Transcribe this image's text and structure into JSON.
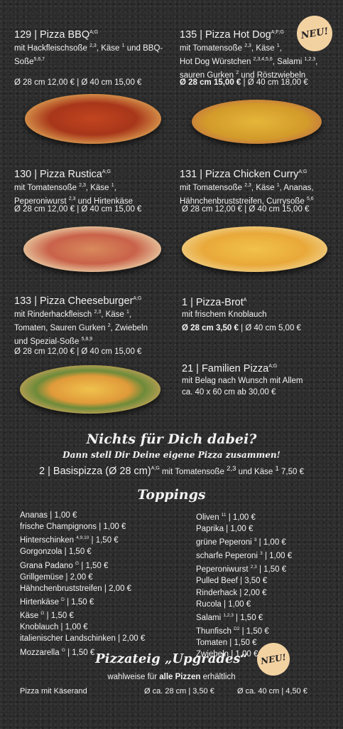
{
  "pizzas": {
    "bbq": {
      "title": "129 | Pizza BBQ",
      "allergens": "A;G",
      "desc_html": "mit Hackfleischsoße <sup>2,3</sup>, Käse <sup>1</sup> und BBQ-Soße<sup>5,6,7</sup>",
      "price_small": "Ø 28 cm 12,00 €",
      "price_large": "Ø 40 cm 15,00 €"
    },
    "hotdog": {
      "title": "135 | Pizza Hot Dog",
      "allergens": "A;F;G",
      "desc_html": "mit Tomatensoße <sup>2,3</sup>, Käse <sup>1</sup>,<br>Hot Dog Würstchen <sup>2,3,4,5,6</sup>, Salami <sup>1,2,3</sup>,<br>sauren Gurken <sup>2</sup> und Röstzwiebeln",
      "price_small": "Ø 28 cm 15,00 €",
      "price_large": "Ø 40 cm 18,00 €"
    },
    "rustica": {
      "title": "130 | Pizza Rustica",
      "allergens": "A;G",
      "desc_html": "mit Tomatensoße <sup>2,3</sup>, Käse <sup>1</sup>,<br>Peperoniwurst <sup>2,3</sup> und Hirtenkäse",
      "price_small": "Ø 28 cm 12,00 €",
      "price_large": "Ø 40 cm 15,00 €"
    },
    "chicken": {
      "title": "131 | Pizza Chicken Curry",
      "allergens": "A;G",
      "desc_html": "mit Tomatensoße <sup>2,3</sup>, Käse <sup>1</sup>, Ananas,<br>Hähnchenbruststreifen, Currysoße <sup>5,6</sup>",
      "price_small": "Ø 28 cm 12,00 €",
      "price_large": "Ø 40 cm 15,00 €"
    },
    "cheese": {
      "title": "133 | Pizza Cheeseburger",
      "allergens": "A;G",
      "desc_html": "mit Rinderhackfleisch <sup>2,3</sup>, Käse <sup>1</sup>,<br>Tomaten,  Sauren Gurken <sup>2</sup>, Zwiebeln<br>und  Spezial-Soße <sup>5,8,9</sup>",
      "price_small": "Ø 28 cm 12,00 €",
      "price_large": "Ø 40 cm 15,00 €"
    },
    "brot": {
      "title": "1 | Pizza-Brot",
      "allergens": "A",
      "desc_html": "mit frischem Knoblauch",
      "price_small": "Ø 28 cm 3,50 €",
      "price_large": "Ø 40 cm 5,00 €"
    },
    "familie": {
      "title": "21 | Familien Pizza",
      "allergens": "A;G",
      "desc_html": "mit Belag nach Wunsch mit Allem<br>ca. 40 x 60 cm ab 30,00 €"
    }
  },
  "badge_new": "NEU!",
  "custom": {
    "heading": "Nichts für Dich dabei?",
    "subheading": "Dann stell Dir Deine eigene Pizza zusammen!",
    "basis_title": "2 | Basispizza (Ø 28 cm)",
    "basis_allergens": "A;G",
    "basis_desc_html": " mit Tomatensoße <sup>2,3</sup> und Käse <sup>1</sup> 7,50 €"
  },
  "toppings_heading": "Toppings",
  "toppings_left": [
    "Ananas | 1,00 €",
    "frische Champignons | 1,00 €",
    "Hinterschinken <sup>4,9,10</sup> | 1,50 €",
    "Gorgonzola | 1,50 €",
    "Grana Padano <sup>G</sup> | 1,50 €",
    "Grillgemüse | 2,00 €",
    "Hähnchenbruststreifen | 2,00 €",
    "Hirtenkäse <sup>D</sup> | 1,50 €",
    "Käse <sup>G</sup> | 1,50 €",
    "Knoblauch | 1,00 €",
    "italienischer Landschinken | 2,00 €",
    "Mozzarella <sup>G</sup> | 1,50 €"
  ],
  "toppings_right": [
    "Oliven <sup>11</sup> | 1,00 €",
    "Paprika | 1,00 €",
    "grüne Peperoni <sup>3</sup> | 1,00 €",
    "scharfe Peperoni <sup>3</sup> | 1,00 €",
    "Peperoniwurst <sup>2,3</sup> | 1,50 €",
    "Pulled Beef | 3,50 €",
    "Rinderhack | 2,00 €",
    "Rucola | 1,00 €",
    "Salami <sup>1,2,3</sup> | 1,50 €",
    "Thunfisch <sup>D2</sup> | 1,50 €",
    "Tomaten | 1,50 €",
    "Zwiebeln | 1,00 €"
  ],
  "upgrades": {
    "heading": "Pizzateig „Upgrades“",
    "sub_prefix": "wahlweise für ",
    "sub_bold": "alle Pizzen",
    "sub_suffix": " erhältlich",
    "item": "Pizza mit Käserand",
    "price_small": "Ø ca. 28 cm | 3,50 €",
    "price_large": "Ø ca. 40 cm | 4,50 €"
  },
  "colors": {
    "bg": "#2b2b2b",
    "text": "#f2f2f2",
    "badge": "#f3d2a2"
  }
}
